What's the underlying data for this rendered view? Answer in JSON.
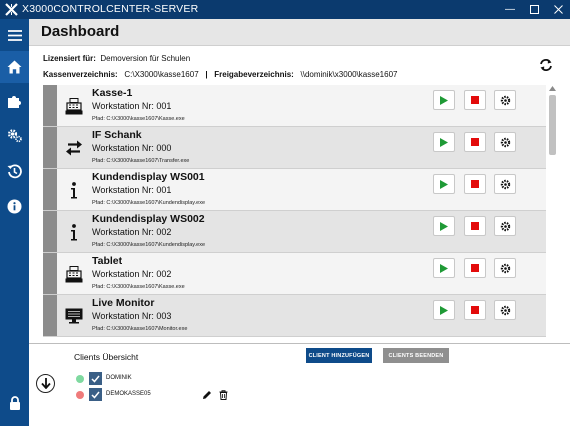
{
  "window": {
    "title": "X3000CONTROLCENTER-SERVER"
  },
  "page": {
    "title": "Dashboard"
  },
  "info": {
    "license_label": "Lizensiert für:",
    "license_value": "Demoversion für Schulen",
    "dir_label": "Kassenverzeichnis:",
    "dir_value": "C:\\X3000\\kasse1607",
    "separator": "|",
    "share_label": "Freigabeverzeichnis:",
    "share_value": "\\\\dominik\\x3000\\kasse1607"
  },
  "clients_list": [
    {
      "name": "Kasse-1",
      "workstation": "Workstation Nr: 001",
      "path": "Pfad:  C:\\X3000\\kasse1607\\Kasse.exe",
      "icon": "cash-register-icon"
    },
    {
      "name": "IF Schank",
      "workstation": "Workstation Nr: 000",
      "path": "Pfad:  C:\\X3000\\kasse1607\\Transfer.exe",
      "icon": "transfer-arrows-icon"
    },
    {
      "name": "Kundendisplay WS001",
      "workstation": "Workstation Nr: 001",
      "path": "Pfad:  C:\\X3000\\kasse1607\\Kundendisplay.exe",
      "icon": "info-icon"
    },
    {
      "name": "Kundendisplay WS002",
      "workstation": "Workstation Nr: 002",
      "path": "Pfad:  C:\\X3000\\kasse1607\\Kundendisplay.exe",
      "icon": "info-icon"
    },
    {
      "name": "Tablet",
      "workstation": "Workstation Nr: 002",
      "path": "Pfad:  C:\\X3000\\kasse1607\\Kasse.exe",
      "icon": "cash-register-icon"
    },
    {
      "name": "Live Monitor",
      "workstation": "Workstation Nr: 003",
      "path": "Pfad:  C:\\X3000\\kasse1607\\Monitor.exe",
      "icon": "monitor-icon"
    }
  ],
  "overview": {
    "title": "Clients Übersicht",
    "add_button": "CLIENT HINZUFÜGEN",
    "stop_button": "CLIENTS BEENDEN",
    "clients": [
      {
        "name": "DOMINIK",
        "status_color": "#7fd9a0"
      },
      {
        "name": "DEMOKASSE05",
        "status_color": "#ef7b7b"
      }
    ]
  },
  "colors": {
    "titlebar": "#0b3a6e",
    "sidebar": "#0e4b8a",
    "play": "#1f9a36",
    "stop": "#e30b0b"
  }
}
